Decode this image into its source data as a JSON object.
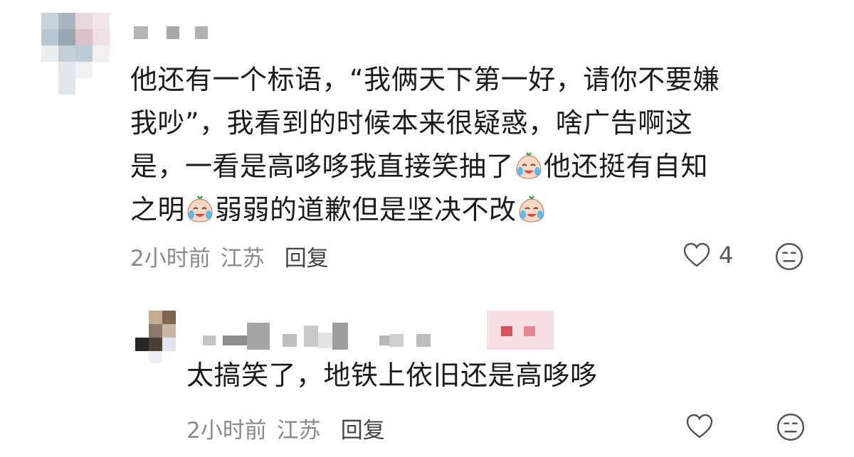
{
  "comment": {
    "text_lines": [
      "他还有一个标语，“我俩天下第一好，请你不要嫌",
      "我吵”，我看到的时候本来很疑惑，啥广告啊这",
      "是，一看是高哆哆我直接笑抽了",
      "之明"
    ],
    "line3_after_emoji": "他还挺有自知",
    "line4_middle": "弱弱的道歉但是坚决不改",
    "time": "2小时前",
    "location": "江苏",
    "reply_label": "回复",
    "like_count": "4",
    "emoji_name": "cry-laugh-emoji"
  },
  "reply": {
    "text": "太搞笑了，地铁上依旧还是高哆哆",
    "time": "2小时前",
    "location": "江苏",
    "reply_label": "回复"
  },
  "colors": {
    "meta_gray": "#8a8a8a",
    "badge_pink": "#f7dfe3",
    "badge_red": "#d9505e"
  }
}
